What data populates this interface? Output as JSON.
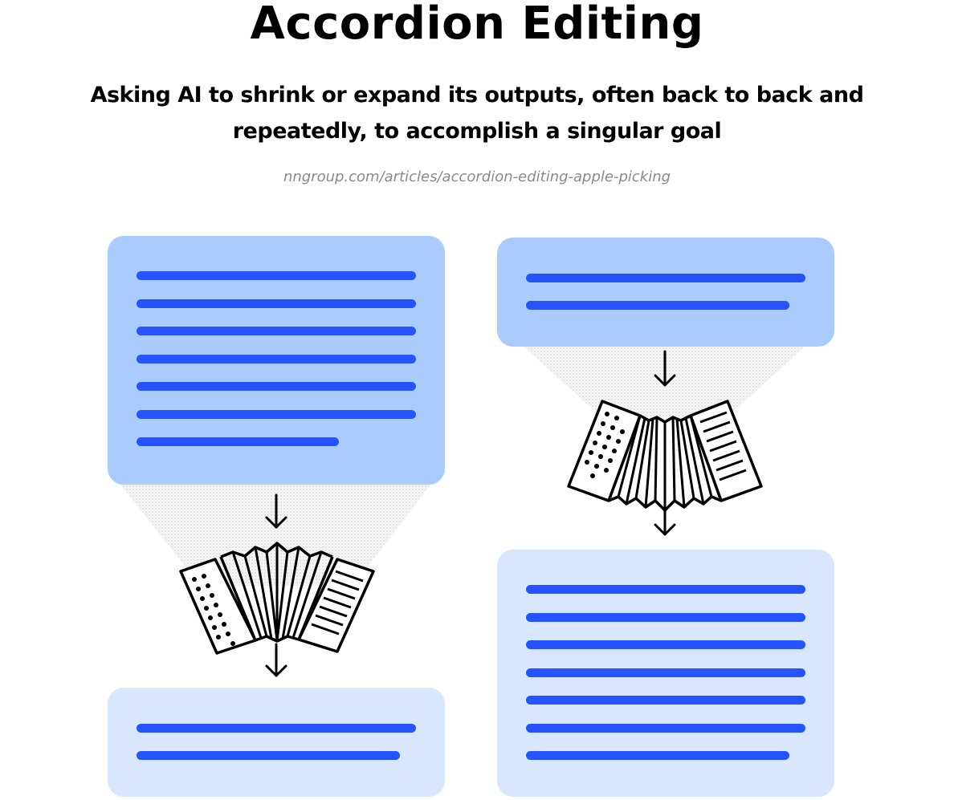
{
  "title": "Accordion Editing",
  "subtitle": "Asking AI to shrink or expand its outputs, often back to back and repeatedly, to accomplish a singular goal",
  "source": "nngroup.com/articles/accordion-editing-apple-picking",
  "icons": [
    "accordion-icon",
    "arrow-down-icon"
  ],
  "colors": {
    "panel_dark": "#a9ccfc",
    "panel_light": "#d8e7fd",
    "text_line": "#2453ff",
    "funnel": "#ececec"
  }
}
